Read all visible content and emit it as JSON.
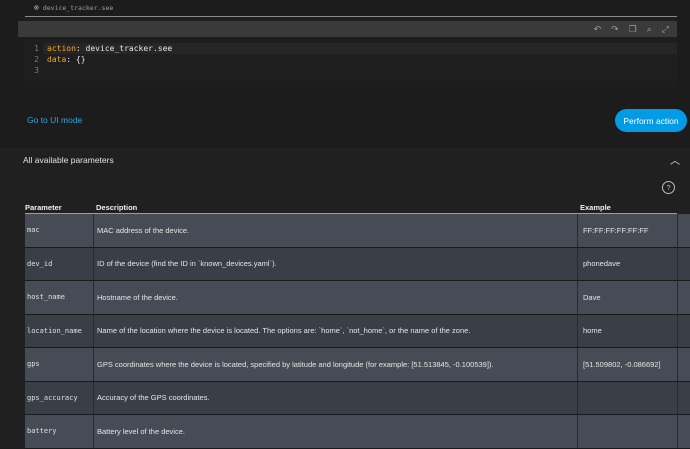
{
  "action_chip": {
    "label": "device_tracker.see"
  },
  "editor": {
    "line_numbers": [
      "1",
      "2",
      "3"
    ],
    "lines": [
      {
        "key": "action",
        "sep": ": ",
        "value": "device_tracker.see"
      },
      {
        "key": "data",
        "sep": ": ",
        "value": "{}"
      },
      {
        "key": "",
        "sep": "",
        "value": ""
      }
    ],
    "toolbar_icons": [
      "undo-icon",
      "redo-icon",
      "copy-icon",
      "search-icon",
      "expand-icon"
    ]
  },
  "actions": {
    "ui_mode_link": "Go to UI mode",
    "perform_button": "Perform action"
  },
  "params": {
    "header": "All available parameters",
    "columns": [
      "Parameter",
      "Description",
      "Example"
    ],
    "rows": [
      {
        "name": "mac",
        "description": "MAC address of the device.",
        "example": "FF:FF:FF:FF:FF:FF"
      },
      {
        "name": "dev_id",
        "description": "ID of the device (find the ID in `known_devices.yaml`).",
        "example": "phonedave"
      },
      {
        "name": "host_name",
        "description": "Hostname of the device.",
        "example": "Dave"
      },
      {
        "name": "location_name",
        "description": "Name of the location where the device is located. The options are: `home`, `not_home`, or the name of the zone.",
        "example": "home"
      },
      {
        "name": "gps",
        "description": "GPS coordinates where the device is located, specified by latitude and longitude (for example: [51.513845, -0.100539]).",
        "example": "[51.509802, -0.086692]"
      },
      {
        "name": "gps_accuracy",
        "description": "Accuracy of the GPS coordinates.",
        "example": ""
      },
      {
        "name": "battery",
        "description": "Battery level of the device.",
        "example": ""
      }
    ]
  },
  "colors": {
    "accent": "#039be5",
    "link": "#2aa7e0",
    "yaml_key": "#f5a623"
  }
}
